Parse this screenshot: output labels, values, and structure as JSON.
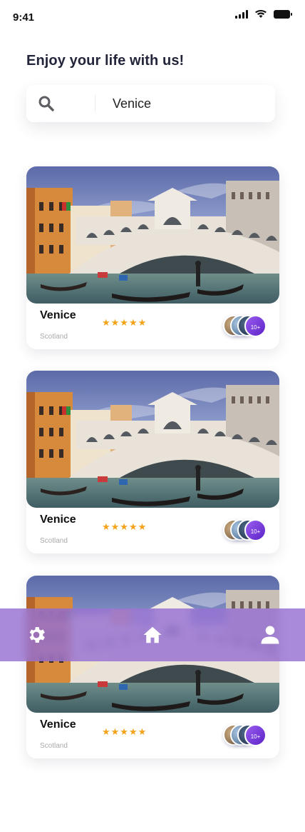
{
  "status_bar": {
    "time": "9:41"
  },
  "headline": "Enjoy your life with us!",
  "search": {
    "value": "Venice"
  },
  "cards": [
    {
      "title": "Venice",
      "location": "Scotland",
      "rating_stars": "★★★★★",
      "rating": 5,
      "avatar_count": "10+"
    },
    {
      "title": "Venice",
      "location": "Scotland",
      "rating_stars": "★★★★★",
      "rating": 5,
      "avatar_count": "10+"
    },
    {
      "title": "Venice",
      "location": "Scotland",
      "rating_stars": "★★★★★",
      "rating": 5,
      "avatar_count": "10+"
    }
  ],
  "nav": {
    "items": [
      "gear-icon",
      "home-icon",
      "user-icon"
    ],
    "background": "#9670d2"
  },
  "colors": {
    "star": "#f5a21b",
    "accent": "#7c3fe0"
  }
}
